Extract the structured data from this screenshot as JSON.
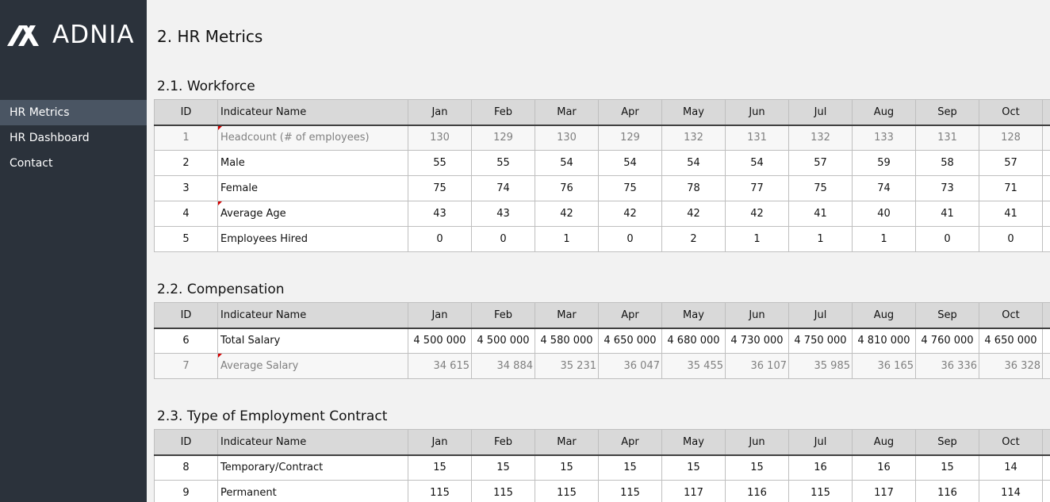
{
  "brand": {
    "name": "ADNIA"
  },
  "nav": [
    {
      "label": "HR Metrics",
      "active": true
    },
    {
      "label": "HR Dashboard",
      "active": false
    },
    {
      "label": "Contact",
      "active": false
    }
  ],
  "page_title": "2. HR Metrics",
  "columns": {
    "id": "ID",
    "name": "Indicateur Name",
    "months": [
      "Jan",
      "Feb",
      "Mar",
      "Apr",
      "May",
      "Jun",
      "Jul",
      "Aug",
      "Sep",
      "Oct"
    ]
  },
  "sections": [
    {
      "title": "2.1. Workforce",
      "rows": [
        {
          "id": "1",
          "name": "Headcount (# of employees)",
          "calc": true,
          "flag": true,
          "values": [
            "130",
            "129",
            "130",
            "129",
            "132",
            "131",
            "132",
            "133",
            "131",
            "128"
          ]
        },
        {
          "id": "2",
          "name": "Male",
          "calc": false,
          "flag": false,
          "values": [
            "55",
            "55",
            "54",
            "54",
            "54",
            "54",
            "57",
            "59",
            "58",
            "57"
          ]
        },
        {
          "id": "3",
          "name": "Female",
          "calc": false,
          "flag": false,
          "values": [
            "75",
            "74",
            "76",
            "75",
            "78",
            "77",
            "75",
            "74",
            "73",
            "71"
          ]
        },
        {
          "id": "4",
          "name": "Average Age",
          "calc": false,
          "flag": true,
          "values": [
            "43",
            "43",
            "42",
            "42",
            "42",
            "42",
            "41",
            "40",
            "41",
            "41"
          ]
        },
        {
          "id": "5",
          "name": "Employees Hired",
          "calc": false,
          "flag": false,
          "values": [
            "0",
            "0",
            "1",
            "0",
            "2",
            "1",
            "1",
            "1",
            "0",
            "0"
          ]
        }
      ]
    },
    {
      "title": "2.2. Compensation",
      "rows": [
        {
          "id": "6",
          "name": "Total Salary",
          "calc": false,
          "flag": false,
          "values": [
            "4 500 000",
            "4 500 000",
            "4 580 000",
            "4 650 000",
            "4 680 000",
            "4 730 000",
            "4 750 000",
            "4 810 000",
            "4 760 000",
            "4 650 000"
          ]
        },
        {
          "id": "7",
          "name": "Average Salary",
          "calc": true,
          "flag": true,
          "values": [
            "34 615",
            "34 884",
            "35 231",
            "36 047",
            "35 455",
            "36 107",
            "35 985",
            "36 165",
            "36 336",
            "36 328"
          ]
        }
      ]
    },
    {
      "title": "2.3. Type of Employment Contract",
      "rows": [
        {
          "id": "8",
          "name": "Temporary/Contract",
          "calc": false,
          "flag": false,
          "values": [
            "15",
            "15",
            "15",
            "15",
            "15",
            "15",
            "16",
            "16",
            "15",
            "14"
          ]
        },
        {
          "id": "9",
          "name": "Permanent",
          "calc": false,
          "flag": false,
          "values": [
            "115",
            "115",
            "115",
            "115",
            "117",
            "116",
            "115",
            "117",
            "116",
            "114"
          ]
        }
      ]
    }
  ]
}
